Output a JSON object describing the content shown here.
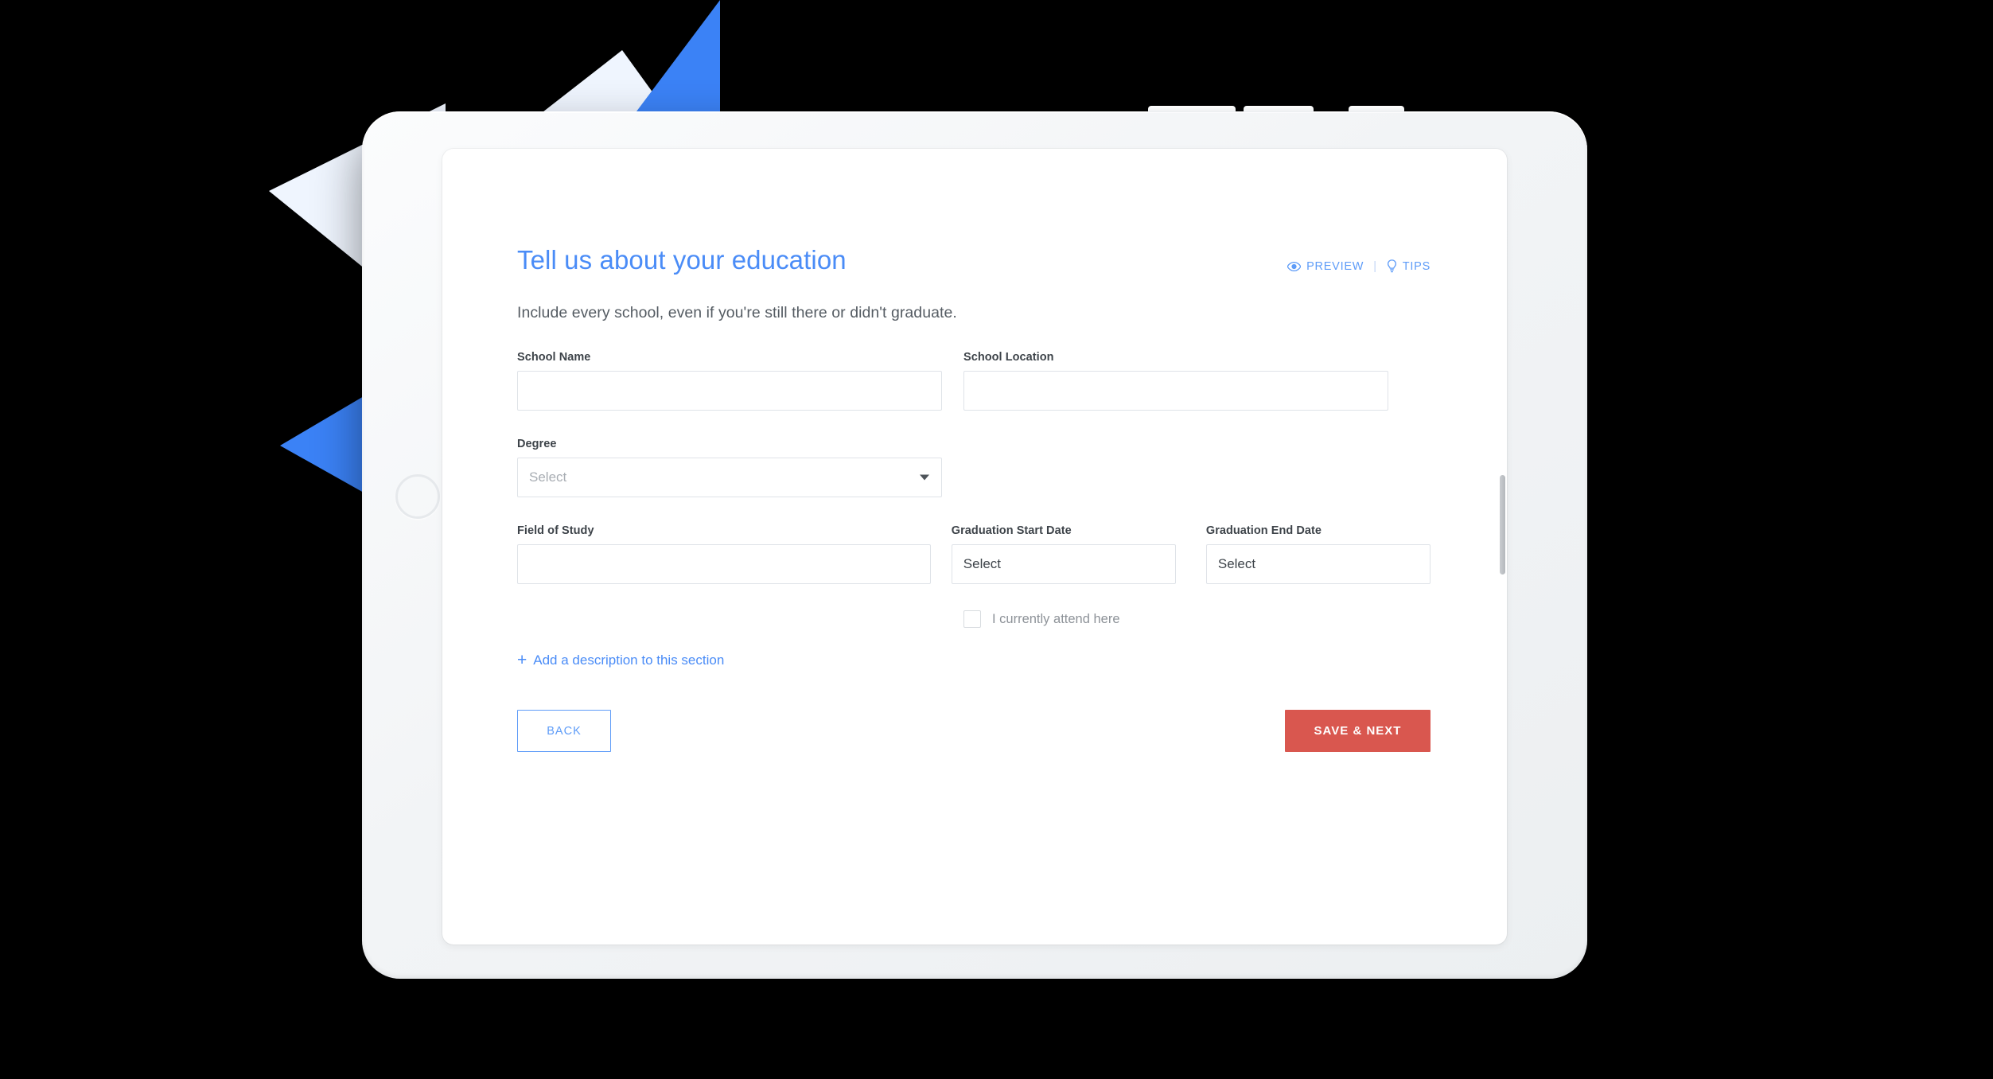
{
  "device": {
    "type": "tablet",
    "home_button": "home-button",
    "edge_buttons": 3,
    "frame_color": "#f2f4f6"
  },
  "decor": {
    "pale_blue": "#eff5fe",
    "vivid_blue": "#3b82f6"
  },
  "theme": {
    "accent_blue": "#4a8cf7",
    "link_blue": "#5e9cf8",
    "save_red": "#d9574f",
    "label_gray": "#3d4349",
    "muted_gray": "#8d9298",
    "border_gray": "#dfe3e8"
  },
  "header": {
    "title": "Tell us about your education",
    "subtitle": "Include every school, even if you're still there or didn't graduate.",
    "actions": {
      "preview_label": "PREVIEW",
      "preview_icon": "eye-icon",
      "separator": "|",
      "tips_label": "TIPS",
      "tips_icon": "lightbulb-icon"
    }
  },
  "form": {
    "school_name": {
      "label": "School Name",
      "value": "",
      "placeholder": ""
    },
    "school_location": {
      "label": "School Location",
      "value": "",
      "placeholder": ""
    },
    "degree": {
      "label": "Degree",
      "value": "",
      "placeholder": "Select",
      "caret_icon": "chevron-down-icon"
    },
    "field_of_study": {
      "label": "Field of Study",
      "value": "",
      "placeholder": ""
    },
    "graduation_start_date": {
      "label": "Graduation Start Date",
      "value": "Select"
    },
    "graduation_end_date": {
      "label": "Graduation End Date",
      "value": "Select"
    },
    "currently_attend": {
      "label": "I currently attend here",
      "checked": false
    },
    "add_description": {
      "plus": "+",
      "label": "Add a description to this section"
    }
  },
  "footer": {
    "back_label": "BACK",
    "save_next_label": "SAVE & NEXT"
  }
}
